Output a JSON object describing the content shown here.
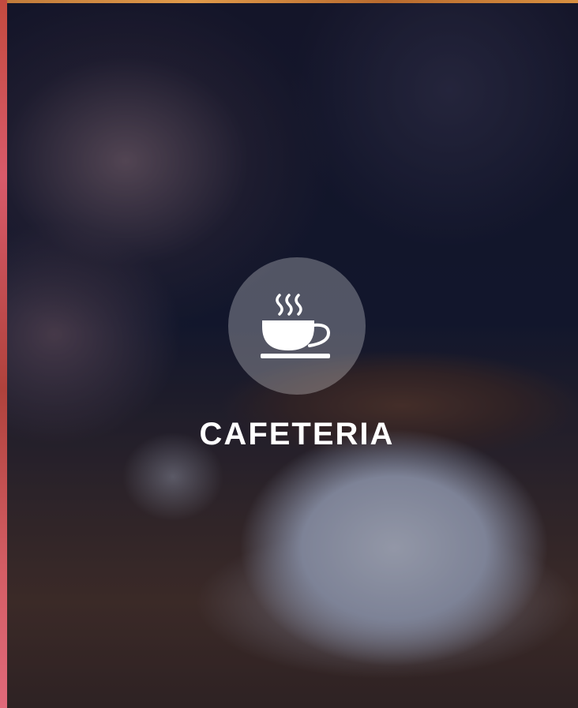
{
  "tile": {
    "title": "CAFETERIA",
    "icon": "coffee-cup-icon"
  },
  "colors": {
    "badge_fill": "rgba(255,255,255,0.27)",
    "text": "#ffffff"
  }
}
